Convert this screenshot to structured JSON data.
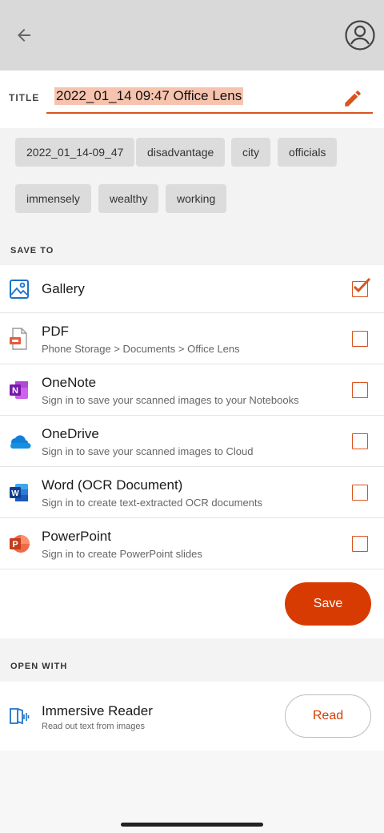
{
  "title": {
    "label": "TITLE",
    "value": "2022_01_14 09:47 Office Lens"
  },
  "tags": [
    "2022_01_14-09_47",
    "disadvantage",
    "city",
    "officials",
    "immensely",
    "wealthy",
    "working"
  ],
  "save_to": {
    "header": "SAVE TO",
    "items": [
      {
        "title": "Gallery",
        "subtitle": "",
        "checked": true,
        "icon": "gallery-icon"
      },
      {
        "title": "PDF",
        "subtitle": "Phone Storage > Documents > Office Lens",
        "checked": false,
        "icon": "pdf-icon"
      },
      {
        "title": "OneNote",
        "subtitle": "Sign in to save your scanned images to your Notebooks",
        "checked": false,
        "icon": "onenote-icon"
      },
      {
        "title": "OneDrive",
        "subtitle": "Sign in to save your scanned images to Cloud",
        "checked": false,
        "icon": "onedrive-icon"
      },
      {
        "title": "Word (OCR Document)",
        "subtitle": "Sign in to create text-extracted OCR documents",
        "checked": false,
        "icon": "word-icon"
      },
      {
        "title": "PowerPoint",
        "subtitle": "Sign in to create PowerPoint slides",
        "checked": false,
        "icon": "powerpoint-icon"
      }
    ],
    "save_label": "Save"
  },
  "open_with": {
    "header": "OPEN WITH",
    "item": {
      "title": "Immersive Reader",
      "subtitle": "Read out text from images",
      "icon": "immersive-reader-icon"
    },
    "read_label": "Read"
  },
  "colors": {
    "accent": "#d83b01",
    "highlight": "#f6c3ae"
  }
}
